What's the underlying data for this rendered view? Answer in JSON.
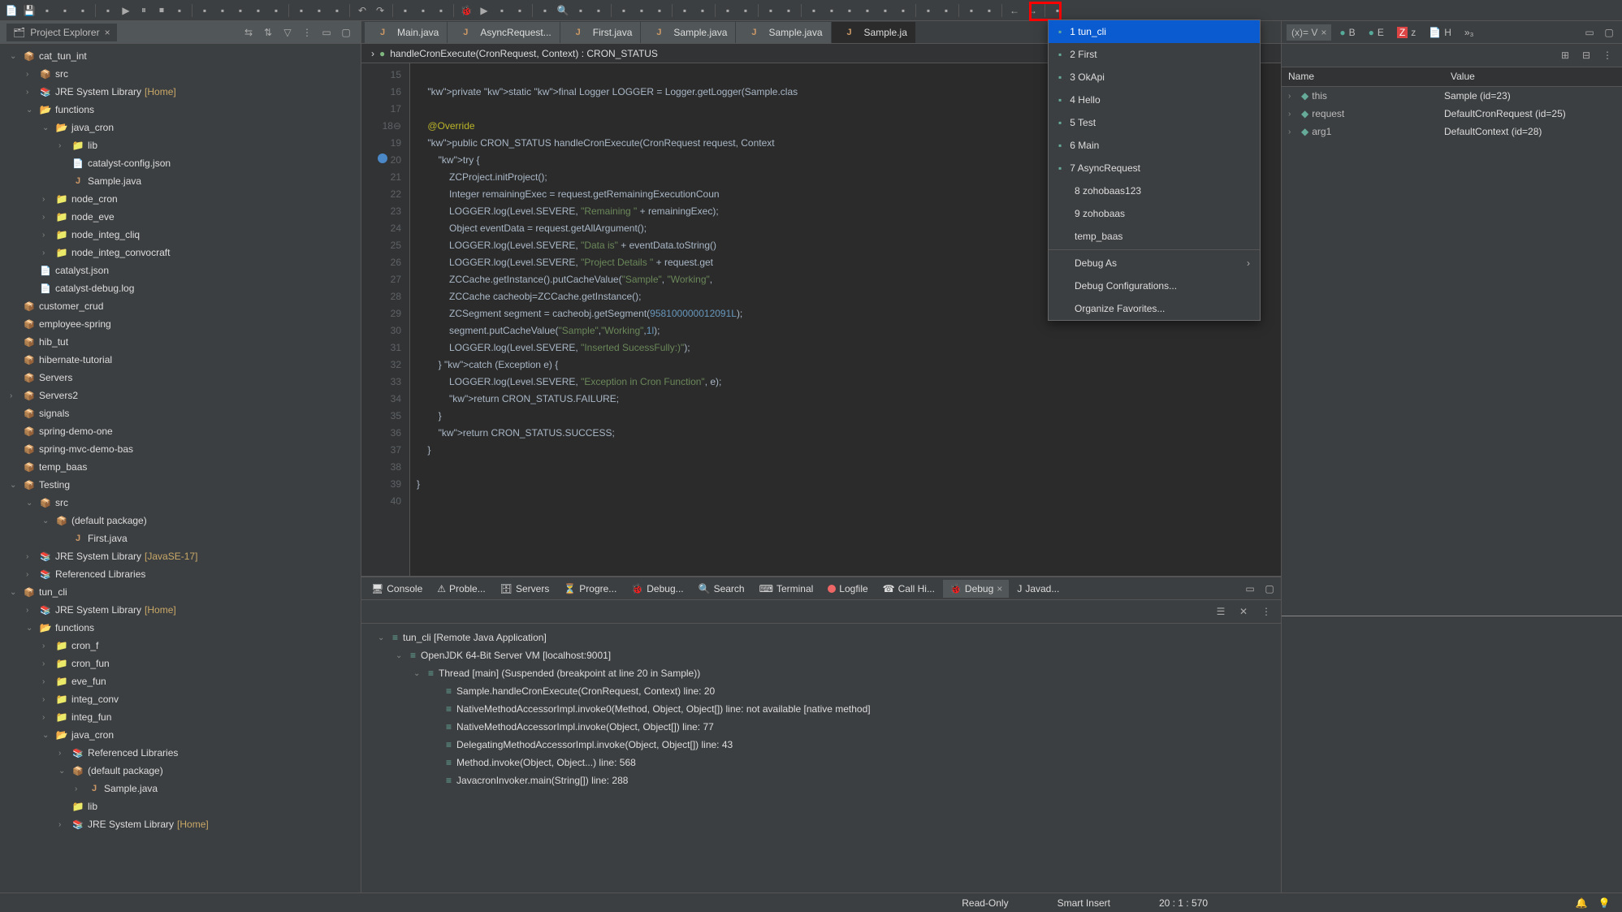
{
  "toolbar_icons": [
    "new",
    "save",
    "save-all",
    "print",
    "build",
    "sep",
    "skip",
    "play",
    "pause",
    "stop",
    "disconnect",
    "sep",
    "step-into",
    "step-over",
    "step-return",
    "run-to",
    "drop",
    "sep",
    "resume",
    "suspend",
    "terminate",
    "sep",
    "undo",
    "redo",
    "sep",
    "cut",
    "copy",
    "paste",
    "sep",
    "debug",
    "run",
    "coverage",
    "profile",
    "sep",
    "ext-tools",
    "search",
    "annotate",
    "task",
    "sep",
    "pin",
    "link",
    "layout",
    "sep",
    "new-window",
    "wizard",
    "sep",
    "toggle",
    "bookmark",
    "sep",
    "nav",
    "class",
    "sep",
    "debug-drop",
    "run-drop",
    "run2-drop",
    "coverage-drop",
    "profile-drop",
    "ext-drop",
    "sep",
    "perspective",
    "customize",
    "sep",
    "open-type",
    "open-task",
    "sep",
    "back",
    "forward",
    "sep",
    "new-java"
  ],
  "project_explorer_title": "Project Explorer",
  "tree": [
    {
      "d": 0,
      "a": "v",
      "i": "proj",
      "t": "cat_tun_int"
    },
    {
      "d": 1,
      "a": ">",
      "i": "pkg",
      "t": "src"
    },
    {
      "d": 1,
      "a": ">",
      "i": "lib",
      "t": "JRE System Library",
      "s": "[Home]"
    },
    {
      "d": 1,
      "a": "v",
      "i": "folder-open",
      "t": "functions"
    },
    {
      "d": 2,
      "a": "v",
      "i": "folder-open",
      "t": "java_cron"
    },
    {
      "d": 3,
      "a": ">",
      "i": "folder",
      "t": "lib"
    },
    {
      "d": 3,
      "a": "",
      "i": "file",
      "t": "catalyst-config.json"
    },
    {
      "d": 3,
      "a": "",
      "i": "java",
      "t": "Sample.java"
    },
    {
      "d": 2,
      "a": ">",
      "i": "folder",
      "t": "node_cron"
    },
    {
      "d": 2,
      "a": ">",
      "i": "folder",
      "t": "node_eve"
    },
    {
      "d": 2,
      "a": ">",
      "i": "folder",
      "t": "node_integ_cliq"
    },
    {
      "d": 2,
      "a": ">",
      "i": "folder",
      "t": "node_integ_convocraft"
    },
    {
      "d": 1,
      "a": "",
      "i": "file",
      "t": "catalyst.json"
    },
    {
      "d": 1,
      "a": "",
      "i": "file",
      "t": "catalyst-debug.log"
    },
    {
      "d": 0,
      "a": "",
      "i": "proj",
      "t": "customer_crud"
    },
    {
      "d": 0,
      "a": "",
      "i": "proj",
      "t": "employee-spring"
    },
    {
      "d": 0,
      "a": "",
      "i": "proj",
      "t": "hib_tut"
    },
    {
      "d": 0,
      "a": "",
      "i": "proj",
      "t": "hibernate-tutorial"
    },
    {
      "d": 0,
      "a": "",
      "i": "proj",
      "t": "Servers"
    },
    {
      "d": 0,
      "a": ">",
      "i": "proj",
      "t": "Servers2"
    },
    {
      "d": 0,
      "a": "",
      "i": "proj",
      "t": "signals"
    },
    {
      "d": 0,
      "a": "",
      "i": "proj",
      "t": "spring-demo-one"
    },
    {
      "d": 0,
      "a": "",
      "i": "proj",
      "t": "spring-mvc-demo-bas"
    },
    {
      "d": 0,
      "a": "",
      "i": "proj",
      "t": "temp_baas"
    },
    {
      "d": 0,
      "a": "v",
      "i": "proj",
      "t": "Testing"
    },
    {
      "d": 1,
      "a": "v",
      "i": "pkg",
      "t": "src"
    },
    {
      "d": 2,
      "a": "v",
      "i": "pkg",
      "t": "(default package)"
    },
    {
      "d": 3,
      "a": "",
      "i": "java",
      "t": "First.java"
    },
    {
      "d": 1,
      "a": ">",
      "i": "lib",
      "t": "JRE System Library",
      "s": "[JavaSE-17]"
    },
    {
      "d": 1,
      "a": ">",
      "i": "lib",
      "t": "Referenced Libraries"
    },
    {
      "d": 0,
      "a": "v",
      "i": "proj",
      "t": "tun_cli"
    },
    {
      "d": 1,
      "a": ">",
      "i": "lib",
      "t": "JRE System Library",
      "s": "[Home]"
    },
    {
      "d": 1,
      "a": "v",
      "i": "folder-open",
      "t": "functions"
    },
    {
      "d": 2,
      "a": ">",
      "i": "folder",
      "t": "cron_f"
    },
    {
      "d": 2,
      "a": ">",
      "i": "folder",
      "t": "cron_fun"
    },
    {
      "d": 2,
      "a": ">",
      "i": "folder",
      "t": "eve_fun"
    },
    {
      "d": 2,
      "a": ">",
      "i": "folder",
      "t": "integ_conv"
    },
    {
      "d": 2,
      "a": ">",
      "i": "folder",
      "t": "integ_fun"
    },
    {
      "d": 2,
      "a": "v",
      "i": "folder-open",
      "t": "java_cron"
    },
    {
      "d": 3,
      "a": ">",
      "i": "lib",
      "t": "Referenced Libraries"
    },
    {
      "d": 3,
      "a": "v",
      "i": "pkg",
      "t": "(default package)"
    },
    {
      "d": 4,
      "a": ">",
      "i": "java",
      "t": "Sample.java"
    },
    {
      "d": 3,
      "a": "",
      "i": "folder",
      "t": "lib"
    },
    {
      "d": 3,
      "a": ">",
      "i": "lib",
      "t": "JRE System Library",
      "s": "[Home]"
    }
  ],
  "editor_tabs": [
    {
      "label": "Main.java"
    },
    {
      "label": "AsyncRequest..."
    },
    {
      "label": "First.java"
    },
    {
      "label": "Sample.java"
    },
    {
      "label": "Sample.java"
    },
    {
      "label": "Sample.ja",
      "active": true
    }
  ],
  "breadcrumb": "handleCronExecute(CronRequest, Context) : CRON_STATUS",
  "code": {
    "start": 15,
    "lines": [
      "",
      "    private static final Logger LOGGER = Logger.getLogger(Sample.clas",
      "",
      "    @Override",
      "    public CRON_STATUS handleCronExecute(CronRequest request, Context",
      "        try {",
      "            ZCProject.initProject();",
      "            Integer remainingExec = request.getRemainingExecutionCoun",
      "            LOGGER.log(Level.SEVERE, \"Remaining \" + remainingExec);",
      "            Object eventData = request.getAllArgument();",
      "            LOGGER.log(Level.SEVERE, \"Data is\" + eventData.toString()",
      "            LOGGER.log(Level.SEVERE, \"Project Details \" + request.get",
      "            ZCCache.getInstance().putCacheValue(\"Sample\", \"Working\",",
      "            ZCCache cacheobj=ZCCache.getInstance();",
      "            ZCSegment segment = cacheobj.getSegment(958100000012091L);",
      "            segment.putCacheValue(\"Sample\",\"Working\",1l);",
      "            LOGGER.log(Level.SEVERE, \"Inserted SucessFully:)\");",
      "        } catch (Exception e) {",
      "            LOGGER.log(Level.SEVERE, \"Exception in Cron Function\", e);",
      "            return CRON_STATUS.FAILURE;",
      "        }",
      "        return CRON_STATUS.SUCCESS;",
      "    }",
      "",
      "}",
      ""
    ]
  },
  "dropdown_items": [
    {
      "label": "1 tun_cli",
      "selected": true,
      "icon": true
    },
    {
      "label": "2 First",
      "icon": true
    },
    {
      "label": "3 OkApi",
      "icon": true
    },
    {
      "label": "4 Hello",
      "icon": true
    },
    {
      "label": "5 Test",
      "icon": true
    },
    {
      "label": "6 Main",
      "icon": true
    },
    {
      "label": "7 AsyncRequest",
      "icon": true
    },
    {
      "label": "8 zohobaas123"
    },
    {
      "label": "9 zohobaas"
    },
    {
      "label": "temp_baas"
    },
    {
      "sep": true
    },
    {
      "label": "Debug As",
      "arrow": true
    },
    {
      "label": "Debug Configurations..."
    },
    {
      "label": "Organize Favorites..."
    }
  ],
  "bottom_tabs": [
    {
      "label": "Console",
      "icon": "🖥"
    },
    {
      "label": "Proble...",
      "icon": "⚠"
    },
    {
      "label": "Servers",
      "icon": "🗄"
    },
    {
      "label": "Progre...",
      "icon": "⏳"
    },
    {
      "label": "Debug...",
      "icon": "🐞"
    },
    {
      "label": "Search",
      "icon": "🔍"
    },
    {
      "label": "Terminal",
      "icon": "⌨"
    },
    {
      "label": "Logfile",
      "dot": "#e66"
    },
    {
      "label": "Call Hi...",
      "icon": "☎"
    },
    {
      "label": "Debug",
      "icon": "🐞",
      "active": true,
      "close": true
    },
    {
      "label": "Javad...",
      "icon": "J"
    }
  ],
  "debug_tree": [
    {
      "d": 0,
      "a": "v",
      "t": "tun_cli [Remote Java Application]"
    },
    {
      "d": 1,
      "a": "v",
      "t": "OpenJDK 64-Bit Server VM [localhost:9001]"
    },
    {
      "d": 2,
      "a": "v",
      "t": "Thread [main] (Suspended (breakpoint at line 20 in Sample))"
    },
    {
      "d": 3,
      "a": "",
      "t": "Sample.handleCronExecute(CronRequest, Context) line: 20"
    },
    {
      "d": 3,
      "a": "",
      "t": "NativeMethodAccessorImpl.invoke0(Method, Object, Object[]) line: not available [native method]"
    },
    {
      "d": 3,
      "a": "",
      "t": "NativeMethodAccessorImpl.invoke(Object, Object[]) line: 77"
    },
    {
      "d": 3,
      "a": "",
      "t": "DelegatingMethodAccessorImpl.invoke(Object, Object[]) line: 43"
    },
    {
      "d": 3,
      "a": "",
      "t": "Method.invoke(Object, Object...) line: 568"
    },
    {
      "d": 3,
      "a": "",
      "t": "JavacronInvoker.main(String[]) line: 288"
    }
  ],
  "right_tabs": [
    "(x)= V",
    "B",
    "E",
    "Z",
    "H"
  ],
  "vars_header": {
    "name": "Name",
    "value": "Value"
  },
  "variables": [
    {
      "name": "this",
      "value": "Sample  (id=23)"
    },
    {
      "name": "request",
      "value": "DefaultCronRequest  (id=25)"
    },
    {
      "name": "arg1",
      "value": "DefaultContext  (id=28)"
    }
  ],
  "statusbar": {
    "readonly": "Read-Only",
    "insert": "Smart Insert",
    "pos": "20 : 1 : 570"
  }
}
